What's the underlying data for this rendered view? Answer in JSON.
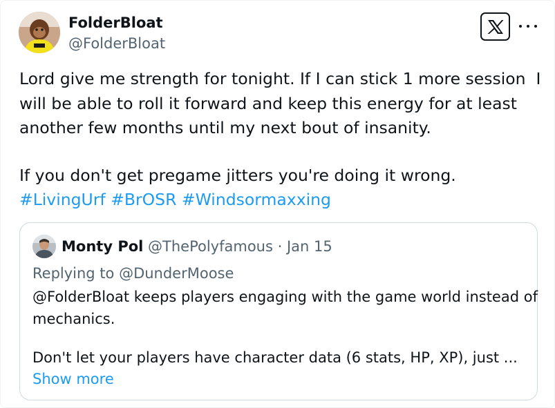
{
  "author": {
    "display_name": "FolderBloat",
    "handle": "@FolderBloat"
  },
  "icons": {
    "platform_logo": "x-logo-icon",
    "more_menu": "more-options-icon"
  },
  "tweet": {
    "lines": [
      "Lord give me strength for tonight. If I can stick 1 more session  I",
      "will be able to roll it forward and keep this energy for at least",
      "another few months until my next bout of insanity.",
      "If you don't get pregame jitters you're doing it wrong."
    ],
    "hashtags": [
      "#LivingUrf",
      "#BrOSR",
      "#Windsormaxxing"
    ]
  },
  "quote": {
    "display_name": "Monty Pol",
    "meta": "@ThePolyfamous · Jan 15",
    "replying_to": "Replying to @DunderMoose",
    "lines": [
      "@FolderBloat keeps players engaging with the game world instead of",
      "mechanics.",
      "Don't let your players have character data (6 stats, HP, XP), just ..."
    ],
    "show_more": "Show more"
  },
  "colors": {
    "text": "#0f1419",
    "secondary": "#536471",
    "link": "#1d9bf0",
    "border": "#cfd9de"
  }
}
